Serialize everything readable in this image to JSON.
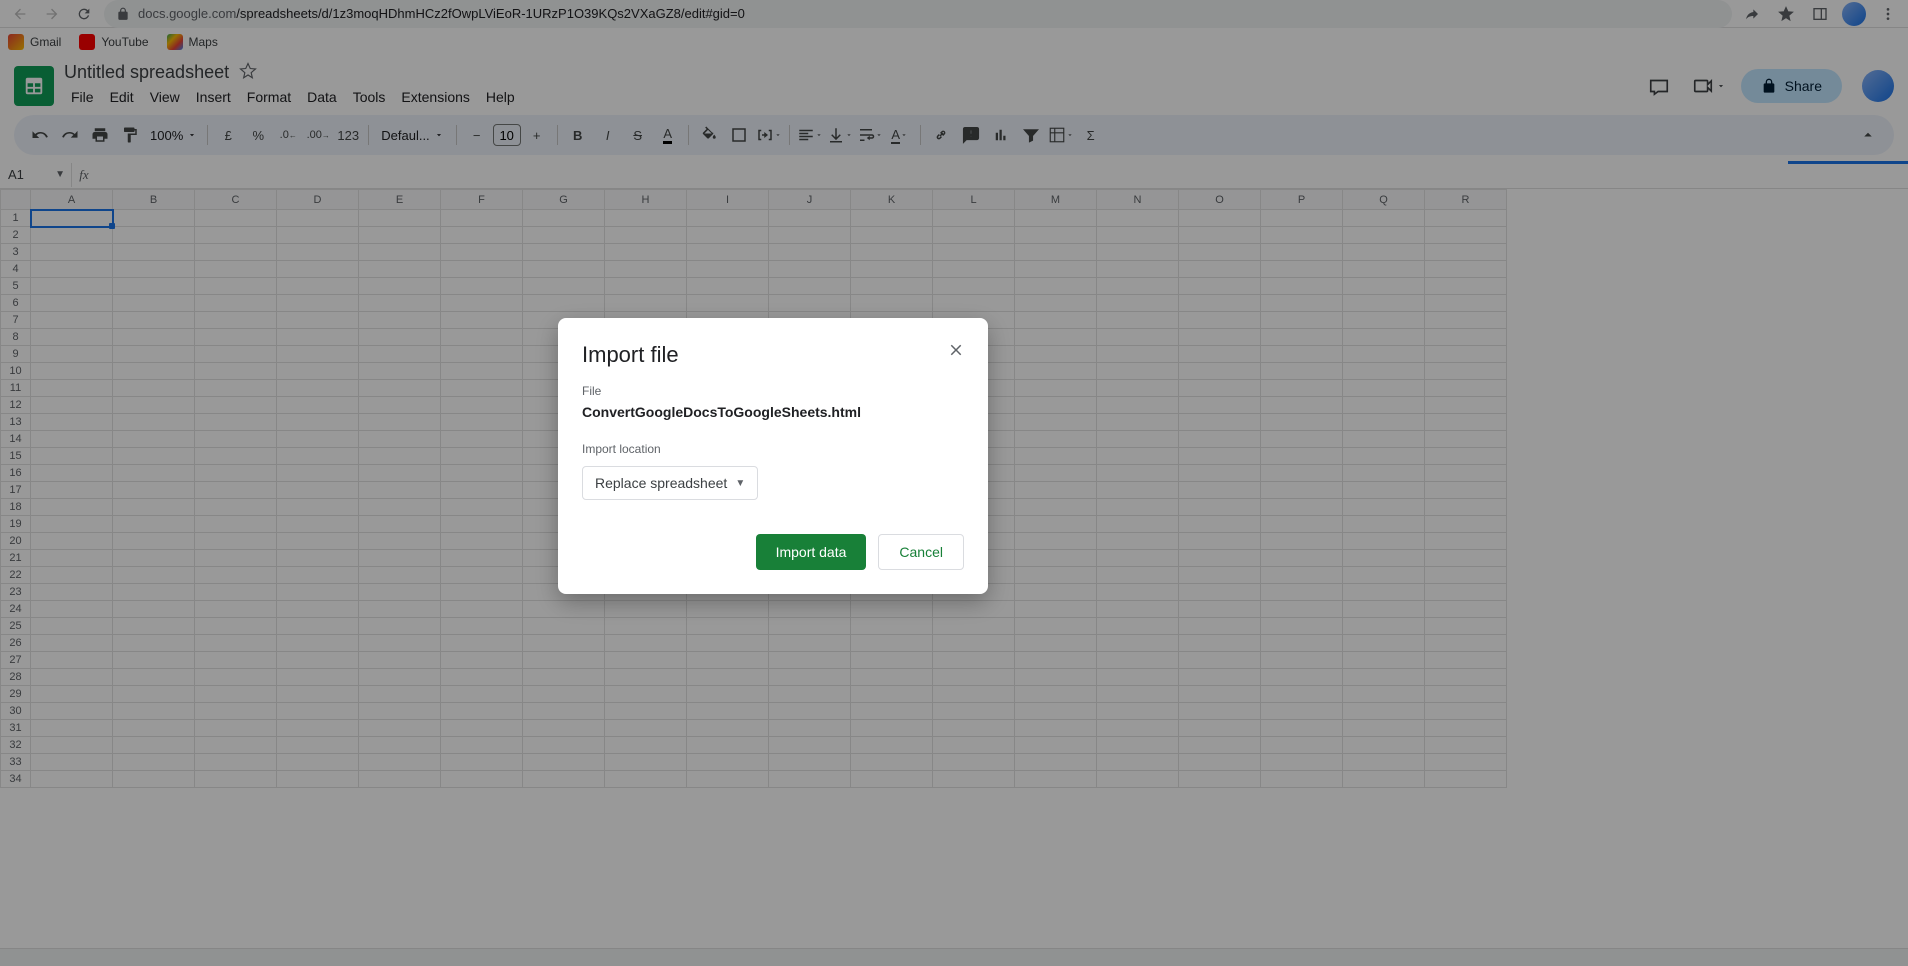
{
  "browser": {
    "url_host": "docs.google.com",
    "url_path": "/spreadsheets/d/1z3moqHDhmHCz2fOwpLViEoR-1URzP1O39KQs2VXaGZ8/edit#gid=0"
  },
  "bookmarks": [
    {
      "label": "Gmail"
    },
    {
      "label": "YouTube"
    },
    {
      "label": "Maps"
    }
  ],
  "doc": {
    "title": "Untitled spreadsheet"
  },
  "menus": [
    "File",
    "Edit",
    "View",
    "Insert",
    "Format",
    "Data",
    "Tools",
    "Extensions",
    "Help"
  ],
  "header_right": {
    "share_label": "Share"
  },
  "toolbar": {
    "zoom": "100%",
    "currency": "£",
    "percent": "%",
    "dec_dec": ".0",
    "inc_dec": ".00",
    "num_123": "123",
    "font_name": "Defaul...",
    "font_size": "10"
  },
  "name_box": "A1",
  "fx_value": "",
  "columns": [
    "A",
    "B",
    "C",
    "D",
    "E",
    "F",
    "G",
    "H",
    "I",
    "J",
    "K",
    "L",
    "M",
    "N",
    "O",
    "P",
    "Q",
    "R"
  ],
  "rows": 34,
  "selected_cell": "A1",
  "dialog": {
    "title": "Import file",
    "file_label": "File",
    "filename": "ConvertGoogleDocsToGoogleSheets.html",
    "location_label": "Import location",
    "location_value": "Replace spreadsheet",
    "primary": "Import data",
    "secondary": "Cancel"
  }
}
